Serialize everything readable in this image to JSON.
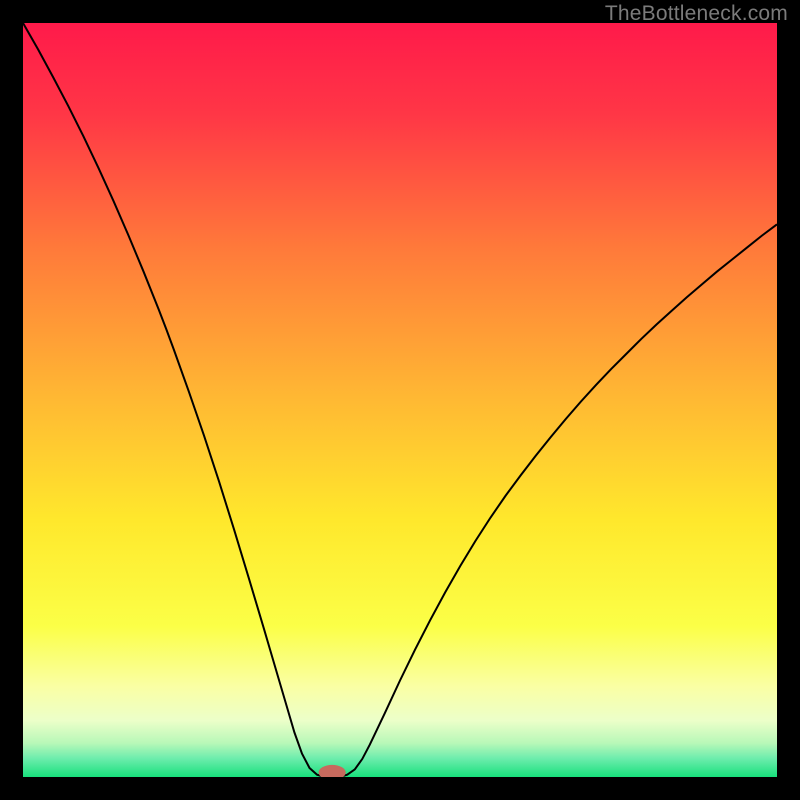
{
  "watermark": "TheBottleneck.com",
  "chart_data": {
    "type": "line",
    "title": "",
    "xlabel": "",
    "ylabel": "",
    "x_range": [
      0,
      100
    ],
    "y_range": [
      0,
      100
    ],
    "curve_minimum_x": 41,
    "background": {
      "type": "vertical-gradient",
      "stops": [
        {
          "offset": 0.0,
          "color": "#ff1a4a"
        },
        {
          "offset": 0.12,
          "color": "#ff3646"
        },
        {
          "offset": 0.3,
          "color": "#ff7a3a"
        },
        {
          "offset": 0.5,
          "color": "#ffb933"
        },
        {
          "offset": 0.66,
          "color": "#ffe82c"
        },
        {
          "offset": 0.8,
          "color": "#fbff47"
        },
        {
          "offset": 0.88,
          "color": "#faffa4"
        },
        {
          "offset": 0.925,
          "color": "#ecffc9"
        },
        {
          "offset": 0.955,
          "color": "#b8f8b8"
        },
        {
          "offset": 0.975,
          "color": "#6eedad"
        },
        {
          "offset": 1.0,
          "color": "#18e07c"
        }
      ]
    },
    "series": [
      {
        "name": "bottleneck-curve",
        "color": "#000000",
        "x": [
          0,
          2,
          4,
          6,
          8,
          10,
          12,
          14,
          16,
          18,
          19,
          20,
          22,
          24,
          26,
          28,
          30,
          32,
          34,
          35,
          36,
          37,
          38,
          39,
          40,
          41,
          42,
          43,
          44,
          45,
          46,
          48,
          50,
          52,
          54,
          56,
          58,
          60,
          62,
          64,
          66,
          68,
          70,
          72,
          74,
          76,
          78,
          80,
          82,
          84,
          86,
          88,
          90,
          92,
          94,
          96,
          98,
          100
        ],
        "y": [
          100,
          96.5,
          92.8,
          89.0,
          85.0,
          80.8,
          76.4,
          71.8,
          67.0,
          62.0,
          59.4,
          56.7,
          51.1,
          45.3,
          39.2,
          32.8,
          26.2,
          19.5,
          12.7,
          9.3,
          5.9,
          3.1,
          1.2,
          0.3,
          0.0,
          0.0,
          0.0,
          0.3,
          1.0,
          2.4,
          4.3,
          8.5,
          12.8,
          16.9,
          20.8,
          24.5,
          28.0,
          31.3,
          34.4,
          37.3,
          40.0,
          42.6,
          45.1,
          47.5,
          49.8,
          52.0,
          54.1,
          56.1,
          58.1,
          60.0,
          61.8,
          63.6,
          65.3,
          67.0,
          68.6,
          70.2,
          71.8,
          73.3
        ]
      }
    ],
    "marker": {
      "name": "optimum-marker",
      "x": 41,
      "y": 0.6,
      "rx": 1.8,
      "ry": 1.0,
      "color": "#c76a5e"
    }
  }
}
